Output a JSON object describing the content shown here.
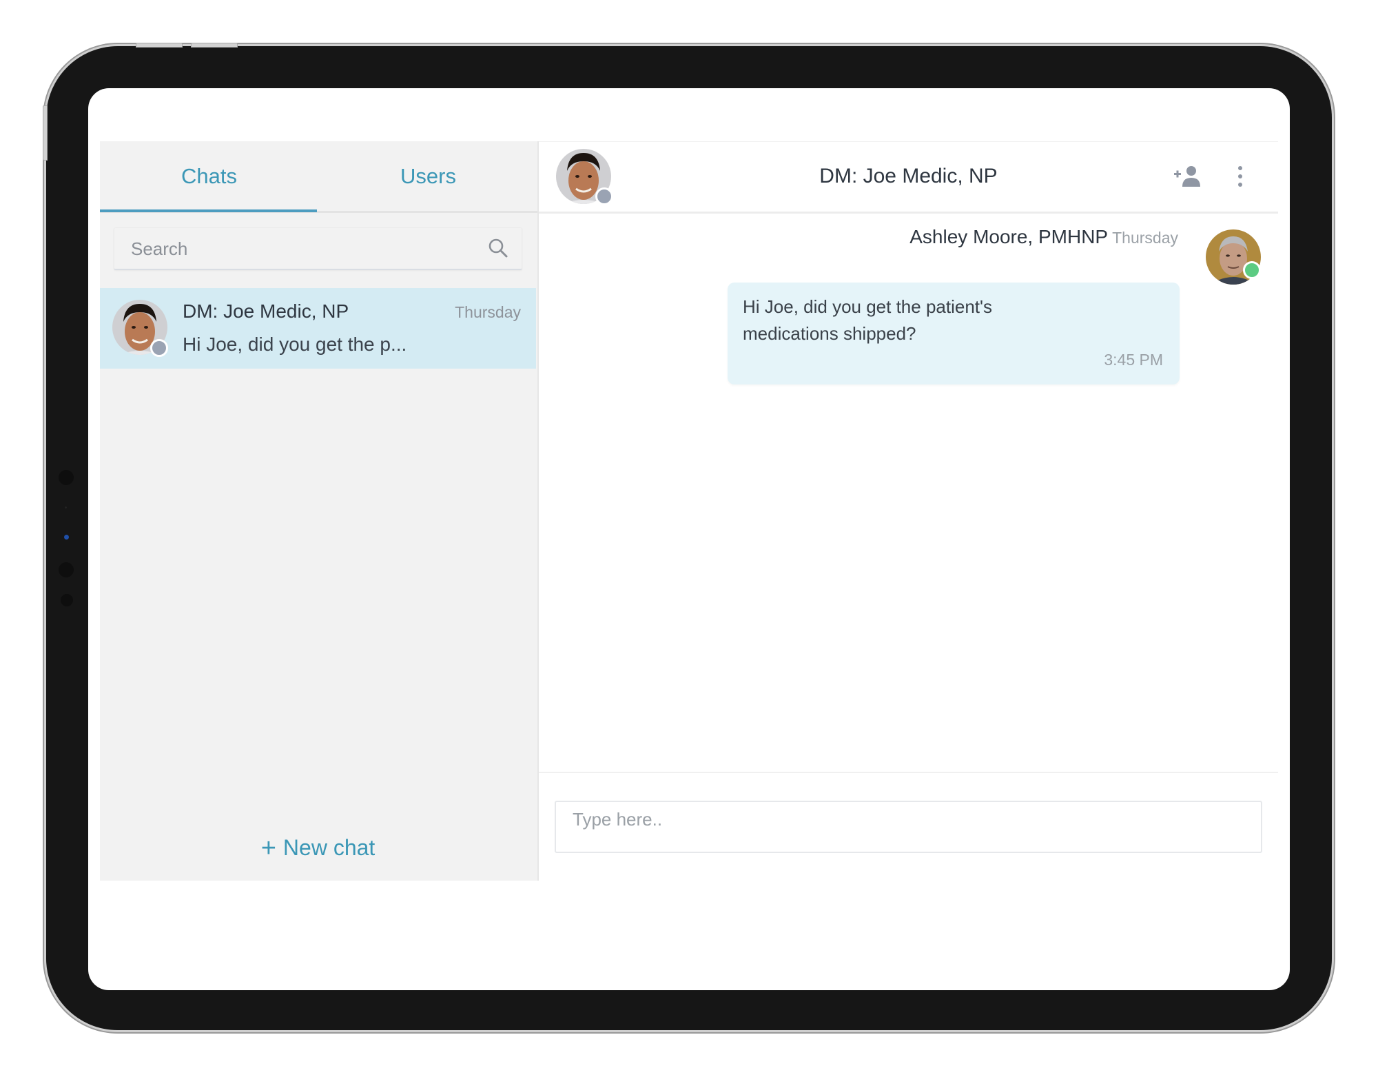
{
  "sidebar": {
    "tabs": [
      {
        "label": "Chats",
        "active": true
      },
      {
        "label": "Users",
        "active": false
      }
    ],
    "search": {
      "placeholder": "Search",
      "value": "",
      "icon": "search-icon"
    },
    "chats": [
      {
        "name": "DM: Joe Medic, NP",
        "time": "Thursday",
        "preview": "Hi Joe, did you get the p...",
        "status": "offline",
        "selected": true
      }
    ],
    "new_chat": {
      "icon": "plus-icon",
      "label": "New chat"
    }
  },
  "conversation": {
    "title": "DM: Joe Medic, NP",
    "header_status": "offline",
    "actions": [
      {
        "icon": "add-person-icon",
        "label": "Add participant"
      },
      {
        "icon": "more-vertical-icon",
        "label": "More options"
      }
    ],
    "messages": [
      {
        "sender": "Ashley Moore, PMHNP",
        "day": "Thursday",
        "text": "Hi Joe, did you get the patient's medications shipped?",
        "time": "3:45 PM",
        "sender_status": "online"
      }
    ],
    "composer": {
      "placeholder": "Type here..",
      "value": ""
    }
  },
  "colors": {
    "accent": "#3b97b6",
    "selected_row": "#d4ebf3",
    "bubble": "#e5f4f9",
    "online": "#5ccb82",
    "offline": "#9aa3b3"
  }
}
